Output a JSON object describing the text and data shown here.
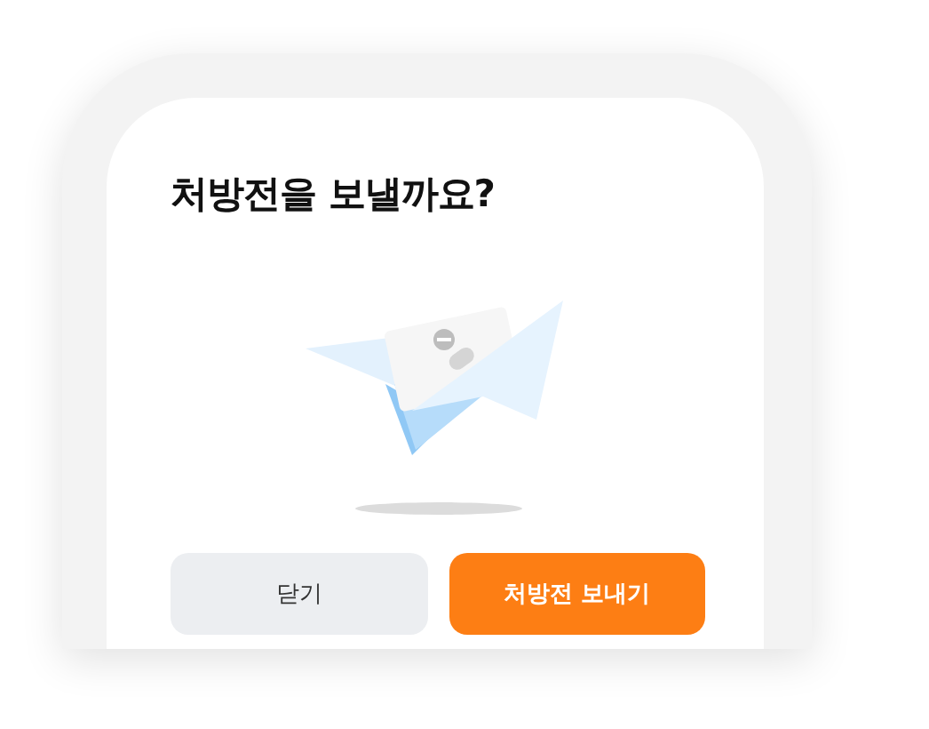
{
  "dialog": {
    "title": "처방전을 보낼까요?"
  },
  "buttons": [
    {
      "label": "닫기",
      "kind": "secondary"
    },
    {
      "label": "처방전 보내기",
      "kind": "primary"
    }
  ]
}
